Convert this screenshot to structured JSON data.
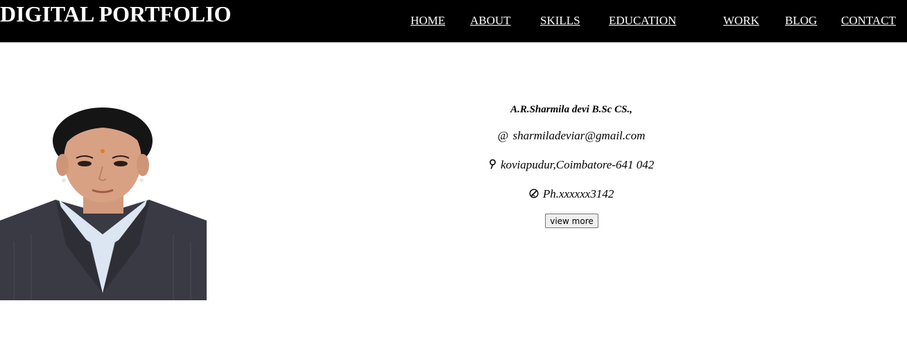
{
  "header": {
    "brand": "DIGITAL PORTFOLIO",
    "nav": [
      "HOME",
      "ABOUT",
      "SKILLS",
      "EDUCATION",
      "WORK",
      "BLOG",
      "CONTACT"
    ]
  },
  "profile": {
    "photo_icon": "profile-photo",
    "name": "A.R.Sharmila devi B.Sc CS.,",
    "email_icon": "@",
    "email": "sharmiladeviar@gmail.com",
    "location_icon": "location-pin-icon",
    "location": "koviapudur,Coimbatore-641 042",
    "phone_icon": "phone-icon",
    "phone": "Ph.xxxxxx3142",
    "button_label": "view more"
  },
  "colors": {
    "header_bg": "#000000",
    "header_text": "#ffffff",
    "jacket": "#3a3a44",
    "collar": "#dce6f2",
    "skin": "#d9a184",
    "hair": "#151515"
  }
}
